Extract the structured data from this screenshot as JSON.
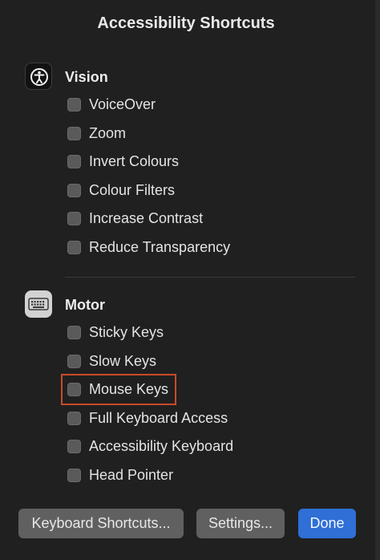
{
  "dialog": {
    "title": "Accessibility Shortcuts"
  },
  "sections": {
    "vision": {
      "title": "Vision",
      "icon": "accessibility-icon",
      "options": [
        "VoiceOver",
        "Zoom",
        "Invert Colours",
        "Colour Filters",
        "Increase Contrast",
        "Reduce Transparency"
      ]
    },
    "motor": {
      "title": "Motor",
      "icon": "keyboard-icon",
      "options": [
        "Sticky Keys",
        "Slow Keys",
        "Mouse Keys",
        "Full Keyboard Access",
        "Accessibility Keyboard",
        "Head Pointer"
      ]
    }
  },
  "buttons": {
    "keyboard_shortcuts": "Keyboard Shortcuts...",
    "settings": "Settings...",
    "done": "Done"
  },
  "colors": {
    "accent": "#2f6fd6",
    "highlight": "#c94a2a"
  }
}
